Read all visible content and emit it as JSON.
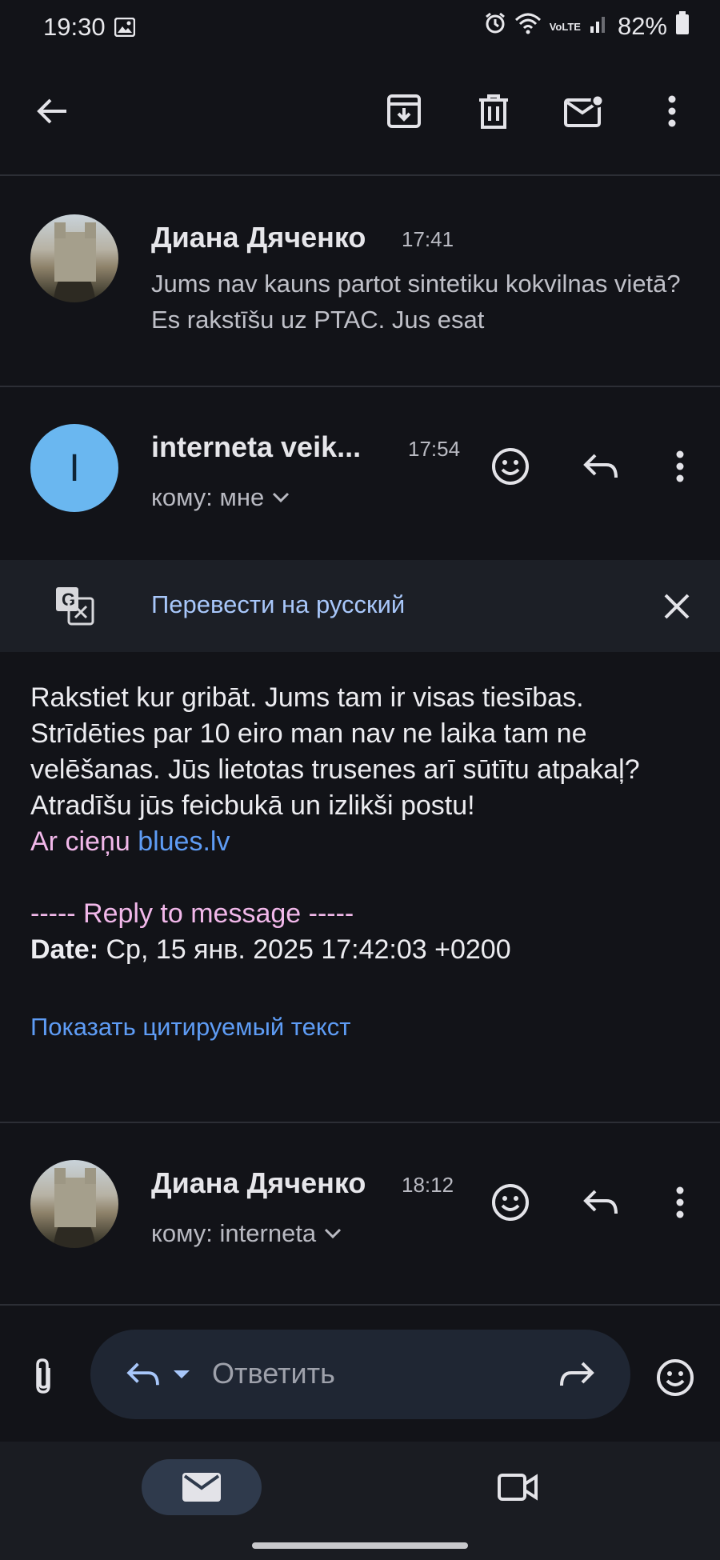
{
  "status_bar": {
    "time": "19:30",
    "battery": "82%",
    "network": "VoLTE"
  },
  "toolbar": {
    "back_icon": "arrow-left-icon",
    "archive_icon": "archive-icon",
    "delete_icon": "trash-icon",
    "unread_icon": "mark-unread-icon",
    "more_icon": "more-vert-icon"
  },
  "messages": [
    {
      "sender": "Диана Дяченко",
      "time": "17:41",
      "snippet": "Jums nav kauns partot sintetiku kokvilnas vietā? Es rakstīšu uz PTAC. Jus esat"
    },
    {
      "sender": "interneta veik...",
      "avatar_letter": "I",
      "time": "17:54",
      "to": "кому: мне"
    },
    {
      "sender": "Диана Дяченко",
      "time": "18:12",
      "to": "кому: interneta"
    }
  ],
  "translate": {
    "label": "Перевести на русский"
  },
  "body": {
    "paragraph": "Rakstiet kur gribāt. Jums tam ir visas tiesības. Strīdēties par 10 eiro man nav ne laika tam ne velēšanas. Jūs lietotas trusenes arī sūtītu atpakaļ? Atradīšu jūs feicbukā un izlikši postu!",
    "regards": "Ar cieņu",
    "link": "blues.lv",
    "reply_header": "----- Reply to message -----",
    "date_label": "Date:",
    "date_value": "Ср, 15 янв. 2025 17:42:03 +0200",
    "show_quoted": "Показать цитируемый текст"
  },
  "reply": {
    "placeholder": "Ответить"
  },
  "colors": {
    "background": "#121318",
    "link": "#5e9cf5",
    "pink": "#f2b8ea",
    "avatar_blue": "#6ab7f0"
  }
}
